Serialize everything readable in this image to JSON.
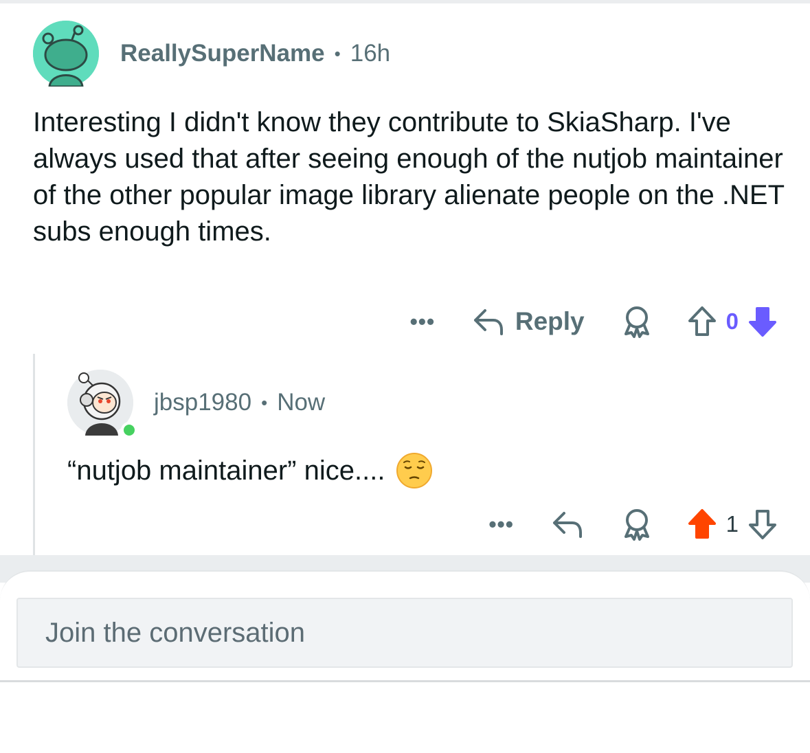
{
  "parent_comment": {
    "author": "ReallySuperName",
    "separator": "•",
    "age": "16h",
    "text": "Interesting I didn't know they contribute to SkiaSharp. I've always used that after seeing enough of the nutjob maintainer of the other popular image library alienate people on the .NET subs enough times.",
    "actions": {
      "more_label": "•••",
      "reply_label": "Reply",
      "score": "0",
      "vote_state": "downvoted",
      "icons": [
        "more-icon",
        "reply-arrow-icon",
        "award-icon",
        "upvote-icon",
        "downvote-icon"
      ]
    },
    "avatar_icon": "snoo-avatar-icon",
    "avatar_color": "#5fdcbc"
  },
  "reply_comment": {
    "author": "jbsp1980",
    "separator": "•",
    "age": "Now",
    "text": "“nutjob maintainer” nice....",
    "emoji": "pensive-face-emoji",
    "online": true,
    "actions": {
      "more_label": "•••",
      "score": "1",
      "vote_state": "upvoted",
      "icons": [
        "more-icon",
        "reply-arrow-icon",
        "award-icon",
        "upvote-icon",
        "downvote-icon"
      ]
    },
    "avatar_icon": "astronaut-avatar-icon"
  },
  "composer": {
    "placeholder": "Join the conversation"
  },
  "colors": {
    "upvote": "#ff4500",
    "downvote": "#6a5cff",
    "meta_text": "#576f76",
    "online": "#46d160"
  }
}
